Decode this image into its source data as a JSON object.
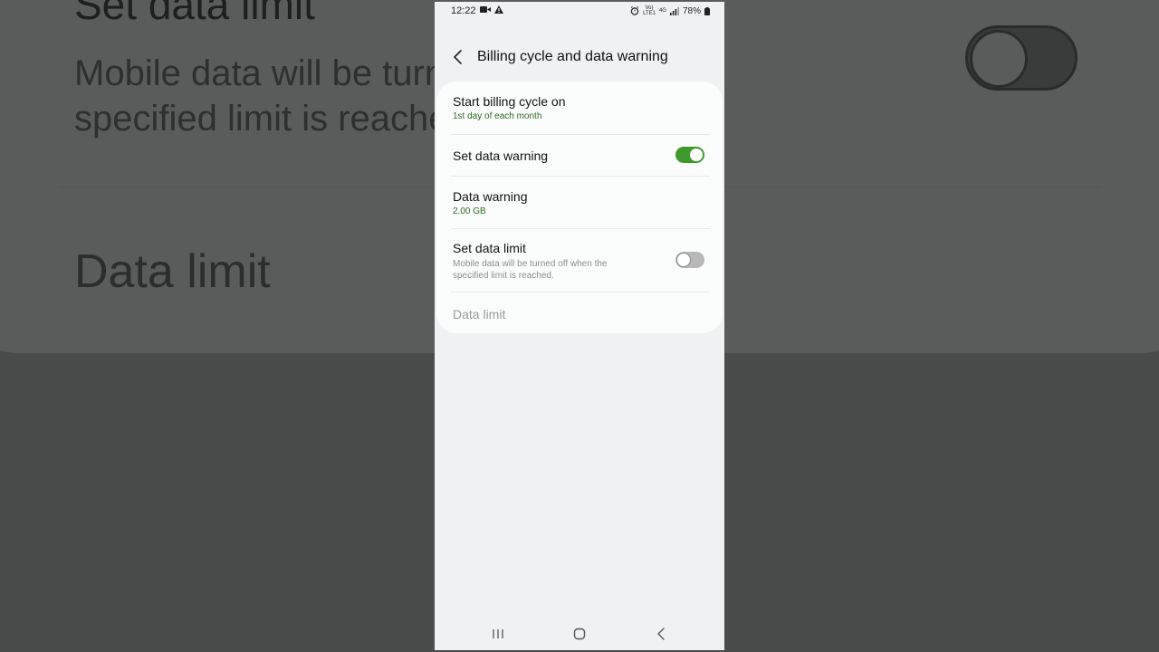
{
  "background": {
    "title": "Set data limit",
    "description": "Mobile data will be turned off when the specified limit is reached.",
    "data_limit_label": "Data limit"
  },
  "statusbar": {
    "time": "12:22",
    "net_top": "Vo)",
    "net_bottom": "LTE1",
    "net_type": "4G",
    "battery": "78%"
  },
  "header": {
    "title": "Billing cycle and data warning"
  },
  "settings": {
    "billing": {
      "title": "Start billing cycle on",
      "value": "1st day of each month"
    },
    "set_warning": {
      "title": "Set data warning",
      "enabled": true
    },
    "warning": {
      "title": "Data warning",
      "value": "2.00 GB"
    },
    "set_limit": {
      "title": "Set data limit",
      "description": "Mobile data will be turned off when the specified limit is reached.",
      "enabled": false
    },
    "limit": {
      "title": "Data limit"
    }
  },
  "colors": {
    "accent_green": "#3f9a2e",
    "value_green": "#2e6b1f",
    "screen_bg": "#eef2f2",
    "card_bg": "#fbfcfc"
  },
  "icons": {
    "back": "chevron-left-icon",
    "recents": "recents-icon",
    "home": "home-icon",
    "nav_back": "nav-back-icon"
  }
}
